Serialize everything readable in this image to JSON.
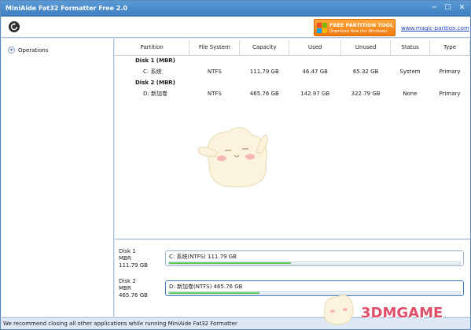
{
  "window": {
    "title": "MiniAide Fat32 Formatter Free 2.0",
    "controls": {
      "minimize": "─",
      "maximize": "☐",
      "close": "✕"
    }
  },
  "toolbar": {
    "refresh_icon": "refresh-icon",
    "promo": {
      "title": "FREE PARTITION TOOL",
      "subtitle": "Download Now (for Windows)"
    },
    "site_link": "www.magic-parition.com"
  },
  "sidebar": {
    "operations_label": "Operations"
  },
  "table": {
    "columns": [
      "Partition",
      "File System",
      "Capacity",
      "Used",
      "Unused",
      "Status",
      "Type"
    ],
    "disks": [
      {
        "label": "Disk 1 (MBR)",
        "partitions": [
          {
            "partition": "C: 系统",
            "fs": "NTFS",
            "capacity": "111.79 GB",
            "used": "46.47 GB",
            "unused": "65.32 GB",
            "status": "System",
            "type": "Primary"
          }
        ]
      },
      {
        "label": "Disk 2 (MBR)",
        "partitions": [
          {
            "partition": "D: 新加卷",
            "fs": "NTFS",
            "capacity": "465.76 GB",
            "used": "142.97 GB",
            "unused": "322.79 GB",
            "status": "None",
            "type": "Primary"
          }
        ]
      }
    ]
  },
  "disk_panel": [
    {
      "name": "Disk 1",
      "scheme": "MBR",
      "size": "111.79 GB",
      "bar_label": "C: 系统(NTFS) 111.79 GB",
      "used_fraction": 0.42
    },
    {
      "name": "Disk 2",
      "scheme": "MBR",
      "size": "465.76 GB",
      "bar_label": "D: 新加卷(NTFS) 465.76 GB",
      "used_fraction": 0.31
    }
  ],
  "status_bar": {
    "message": "We recommend closing all other applications while running MiniAide Fat32 Formatter"
  },
  "watermark": {
    "text": "3DMGAME"
  },
  "colors": {
    "title_bar": "#4a8dcf",
    "promo": "#f58a1f",
    "progress": "#4cc145",
    "link": "#1d3fb8"
  }
}
